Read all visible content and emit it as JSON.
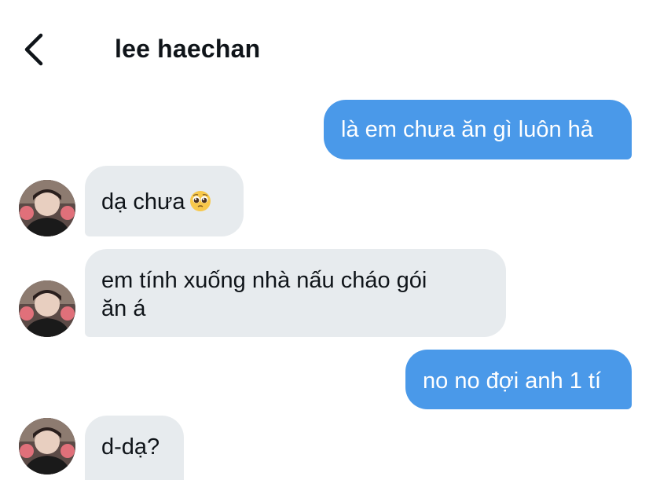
{
  "header": {
    "title": "lee haechan",
    "back_icon": "chevron-left-icon"
  },
  "colors": {
    "sent_bubble": "#4a99e9",
    "received_bubble": "#e7ebee",
    "text": "#0f1419"
  },
  "messages": [
    {
      "direction": "sent",
      "text": "là em chưa ăn gì luôn hả"
    },
    {
      "direction": "received",
      "text": "dạ chưa",
      "emoji": "pleading-face-icon"
    },
    {
      "direction": "received",
      "lines": [
        "em tính xuống nhà nấu cháo gói",
        "ăn á"
      ]
    },
    {
      "direction": "sent",
      "text": "no no đợi anh 1 tí"
    },
    {
      "direction": "received",
      "text": "d-dạ?"
    }
  ]
}
